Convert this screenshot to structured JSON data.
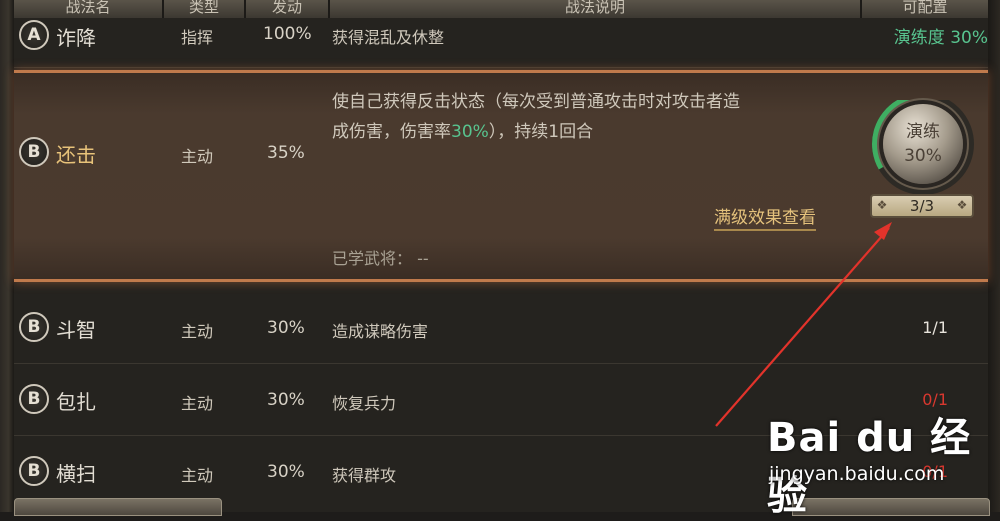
{
  "header": {
    "columns": [
      "战法名",
      "类型",
      "发动",
      "战法说明",
      "可配置"
    ]
  },
  "rows": [
    {
      "grade": "A",
      "name": "诈降",
      "type": "指挥",
      "rate": "100%",
      "desc": "获得混乱及休整",
      "config": "演练度 30%"
    },
    {
      "grade": "B",
      "name": "还击",
      "type": "主动",
      "rate": "35%",
      "desc_line1": "使自己获得反击状态（每次受到普通攻击时对攻击者造",
      "desc_line2_a": "成伤害，伤害率",
      "desc_line2_hl": "30%",
      "desc_line2_b": "），持续1回合",
      "full_effect_link": "满级效果查看",
      "learned_label": "已学武将：",
      "learned_value": "--",
      "orb_label": "演练",
      "orb_value": "30%",
      "orb_counter": "3/3"
    },
    {
      "grade": "B",
      "name": "斗智",
      "type": "主动",
      "rate": "30%",
      "desc": "造成谋略伤害",
      "config": "1/1"
    },
    {
      "grade": "B",
      "name": "包扎",
      "type": "主动",
      "rate": "30%",
      "desc": "恢复兵力",
      "config": "0/1"
    },
    {
      "grade": "B",
      "name": "横扫",
      "type": "主动",
      "rate": "30%",
      "desc": "获得群攻",
      "config": "0/1"
    }
  ],
  "colors": {
    "config_green": "#58c48f",
    "config_white": "#e8e4dc",
    "config_red": "#d9382f",
    "accent_orange": "#c07a4c",
    "arrow_red": "#e2332b"
  },
  "watermark": {
    "logo": "Bai du 经验",
    "url": "jingyan.baidu.com"
  }
}
